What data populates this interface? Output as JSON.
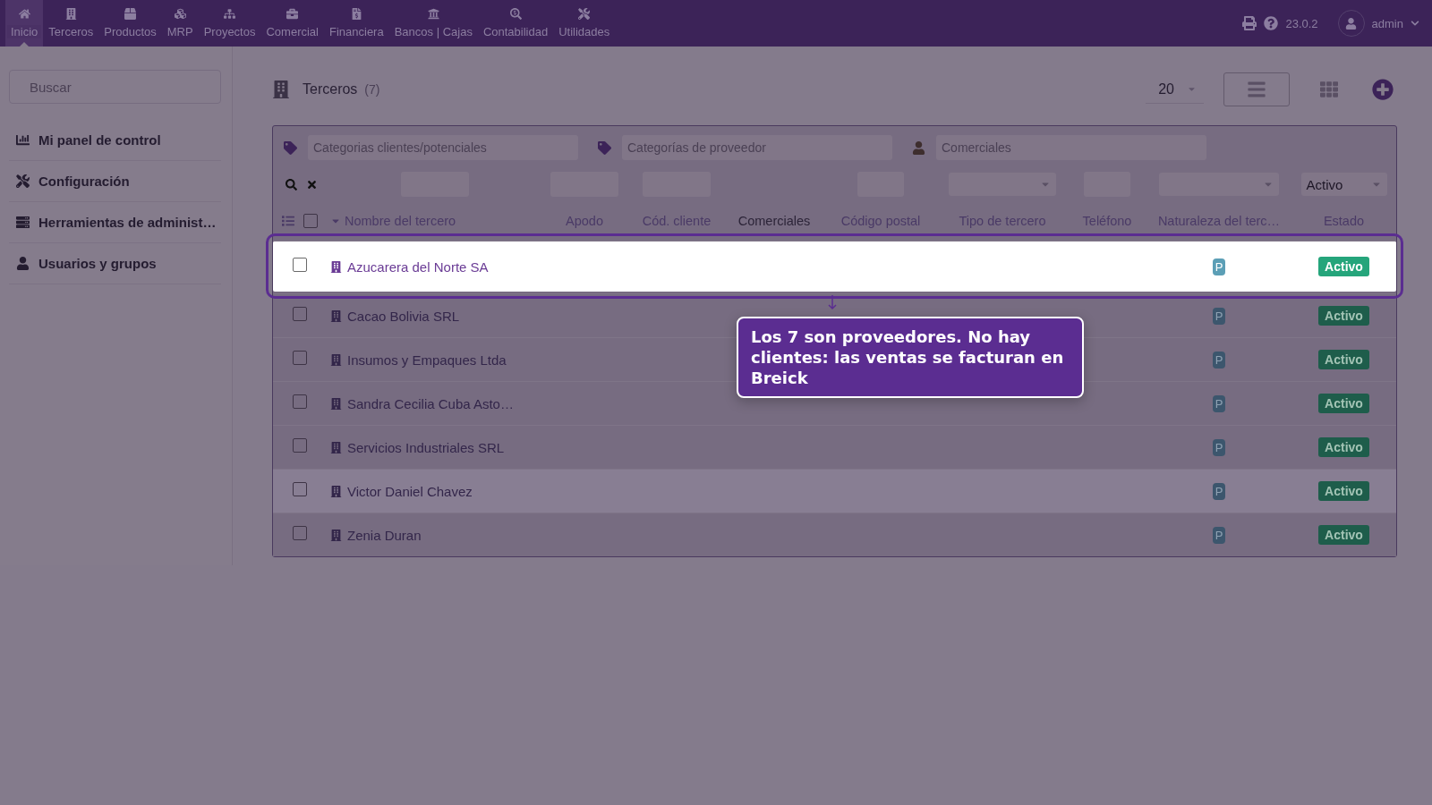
{
  "topbar": {
    "menu": [
      {
        "label": "Inicio",
        "selected": true
      },
      {
        "label": "Terceros",
        "selected": false
      },
      {
        "label": "Productos",
        "selected": false
      },
      {
        "label": "MRP",
        "selected": false
      },
      {
        "label": "Proyectos",
        "selected": false
      },
      {
        "label": "Comercial",
        "selected": false
      },
      {
        "label": "Financiera",
        "selected": false
      },
      {
        "label": "Bancos | Cajas",
        "selected": false
      },
      {
        "label": "Contabilidad",
        "selected": false
      },
      {
        "label": "Utilidades",
        "selected": false
      }
    ],
    "version": "23.0.2",
    "user": "admin"
  },
  "sidebar": {
    "search": {
      "placeholder": "Buscar"
    },
    "items": [
      {
        "label": "Mi panel de control"
      },
      {
        "label": "Configuración"
      },
      {
        "label": "Herramientas de administ…"
      },
      {
        "label": "Usuarios y grupos"
      }
    ]
  },
  "page": {
    "title": "Terceros",
    "count": "(7)",
    "page_size": "20"
  },
  "filters": {
    "category_fields": [
      {
        "placeholder": "Categorias clientes/potenciales"
      },
      {
        "placeholder": "Categorías de proveedor"
      },
      {
        "placeholder": "Comerciales"
      }
    ],
    "status_value": "Activo"
  },
  "table": {
    "select_all_checked": false,
    "columns": [
      {
        "label": "Nombre del tercero",
        "sortable": true,
        "sorted": true
      },
      {
        "label": "Apodo",
        "sortable": true,
        "sorted": false
      },
      {
        "label": "Cód. cliente",
        "sortable": true,
        "sorted": false
      },
      {
        "label": "Comerciales",
        "sortable": false,
        "sorted": false
      },
      {
        "label": "Código postal",
        "sortable": true,
        "sorted": false
      },
      {
        "label": "Tipo de tercero",
        "sortable": true,
        "sorted": false
      },
      {
        "label": "Teléfono",
        "sortable": true,
        "sorted": false
      },
      {
        "label": "Naturaleza del terc…",
        "sortable": true,
        "sorted": false
      },
      {
        "label": "Estado",
        "sortable": true,
        "sorted": false
      }
    ],
    "rows": [
      {
        "name": "Azucarera del Norte SA",
        "nature": "P",
        "status": "Activo",
        "spotlight": true,
        "hovered": false
      },
      {
        "name": "Cacao Bolivia SRL",
        "nature": "P",
        "status": "Activo",
        "spotlight": false,
        "hovered": false
      },
      {
        "name": "Insumos y Empaques Ltda",
        "nature": "P",
        "status": "Activo",
        "spotlight": false,
        "hovered": false
      },
      {
        "name": "Sandra Cecilia Cuba Asto…",
        "nature": "P",
        "status": "Activo",
        "spotlight": false,
        "hovered": false
      },
      {
        "name": "Servicios Industriales SRL",
        "nature": "P",
        "status": "Activo",
        "spotlight": false,
        "hovered": false
      },
      {
        "name": "Victor Daniel Chavez",
        "nature": "P",
        "status": "Activo",
        "spotlight": false,
        "hovered": true
      },
      {
        "name": "Zenia Duran",
        "nature": "P",
        "status": "Activo",
        "spotlight": false,
        "hovered": false
      }
    ]
  },
  "tooltip": {
    "text": "Los 7 son proveedores. No hay clientes: las ventas se facturan en Breick"
  }
}
